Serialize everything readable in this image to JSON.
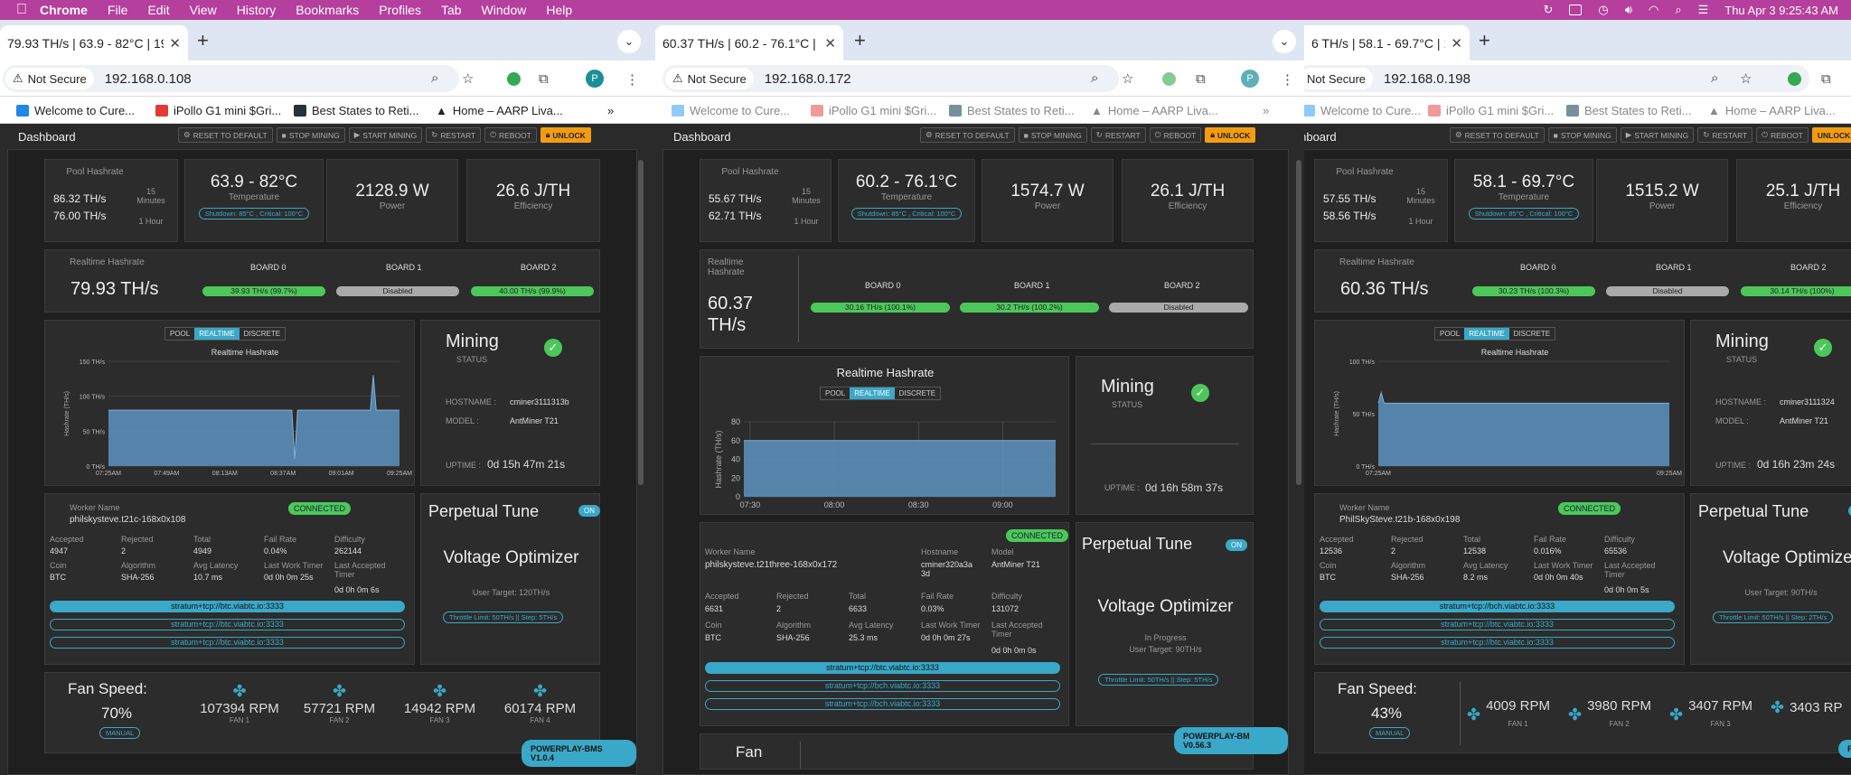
{
  "menubar": {
    "app": "Chrome",
    "items": [
      "File",
      "Edit",
      "View",
      "History",
      "Bookmarks",
      "Profiles",
      "Tab",
      "Window",
      "Help"
    ],
    "clock": "Thu Apr 3  9:25:43 AM"
  },
  "bookmarks": [
    "Welcome to Cure...",
    "iPollo G1 mini $Gri...",
    "Best States to Reti...",
    "Home – AARP Liva..."
  ],
  "common": {
    "not_secure": "Not Secure",
    "dashboard": "Dashboard",
    "buttons": [
      "RESET TO DEFAULT",
      "STOP MINING",
      "START MINING",
      "RESTART",
      "REBOOT"
    ],
    "unlock": "UNLOCK",
    "pool_hashrate": "Pool Hashrate",
    "min15": "15 Minutes",
    "hour1": "1 Hour",
    "temperature": "Temperature",
    "shutdown": "Shutdown: 85°C , Critical: 100°C",
    "power": "Power",
    "efficiency": "Efficiency",
    "realtime_hashrate": "Realtime Hashrate",
    "board0": "BOARD 0",
    "board1": "BOARD 1",
    "board2": "BOARD 2",
    "pool": "POOL",
    "realtime": "REALTIME",
    "discrete": "DISCRETE",
    "mining": "Mining",
    "status": "STATUS",
    "hostname_k": "HOSTNAME :",
    "model_k": "MODEL :",
    "uptime_k": "UPTIME :",
    "worker_name": "Worker Name",
    "connected": "CONNECTED",
    "accepted": "Accepted",
    "rejected": "Rejected",
    "total": "Total",
    "fail_rate": "Fail Rate",
    "difficulty": "Difficulty",
    "coin": "Coin",
    "algorithm": "Algorithm",
    "avg_latency": "Avg Latency",
    "last_work_timer": "Last Work Timer",
    "last_accepted_timer": "Last Accepted Timer",
    "perpetual_tune": "Perpetual Tune",
    "on": "ON",
    "voltage_optimizer": "Voltage Optimizer",
    "fan_speed": "Fan Speed:",
    "manual": "MANUAL",
    "hostname_h": "Hostname",
    "model_h": "Model",
    "fan": "Fan",
    "y_axis": "Hashrate (TH/s)"
  },
  "w1": {
    "tab": "79.93 TH/s | 63.9 - 82°C | 19",
    "url": "192.168.0.108",
    "pool15": "86.32 TH/s",
    "pool1h": "76.00 TH/s",
    "temp": "63.9 - 82°C",
    "power": "2128.9 W",
    "eff": "26.6 J/TH",
    "rt": "79.93 TH/s",
    "b0": "39.93 TH/s (99.7%)",
    "b1": "Disabled",
    "b2": "40.00 TH/s (99.9%)",
    "chart_title": "Realtime Hashrate",
    "hostname": "cminer3111313b",
    "model": "AntMiner T21",
    "uptime": "0d 15h 47m 21s",
    "worker": "philskysteve.t21c-168x0x108",
    "accepted": "4947",
    "rejected": "2",
    "total": "4949",
    "fail": "0.04%",
    "diff": "262144",
    "coin": "BTC",
    "algo": "SHA-256",
    "lat": "10.7 ms",
    "lwt": "0d 0h 0m 25s",
    "lat2": "0d 0h 0m 6s",
    "pools": [
      "stratum+tcp://btc.viabtc.io:3333",
      "stratum+tcp://btc.viabtc.io:3333",
      "stratum+tcp://btc.viabtc.io:3333"
    ],
    "target": "User Target: 120TH/s",
    "throttle": "Throttle Limit: 50TH/s || Step: 5TH/s",
    "fan_pct": "70%",
    "fans": [
      {
        "rpm": "107394 RPM",
        "l": "FAN 1"
      },
      {
        "rpm": "57721 RPM",
        "l": "FAN 2"
      },
      {
        "rpm": "14942 RPM",
        "l": "FAN 3"
      },
      {
        "rpm": "60174 RPM",
        "l": "FAN 4"
      }
    ],
    "version": "POWERPLAY-BMS V1.0.4"
  },
  "w2": {
    "tab": "60.37 TH/s | 60.2 - 76.1°C | 1",
    "url": "192.168.0.172",
    "pool15": "55.67 TH/s",
    "pool1h": "62.71 TH/s",
    "temp": "60.2 - 76.1°C",
    "power": "1574.7 W",
    "eff": "26.1 J/TH",
    "rt1": "60.37",
    "rt2": "TH/s",
    "b0": "30.16 TH/s (100.1%)",
    "b1": "30.2 TH/s (100.2%)",
    "b2": "Disabled",
    "chart_title": "Realtime Hashrate",
    "uptime": "0d 16h 58m 37s",
    "worker": "philskysteve.t21three-168x0x172",
    "hostname": "cminer320a3a3d",
    "model": "AntMiner T21",
    "accepted": "6631",
    "rejected": "2",
    "total": "6633",
    "fail": "0.03%",
    "diff": "131072",
    "coin": "BTC",
    "algo": "SHA-256",
    "lat": "25.3 ms",
    "lwt": "0d 0h 0m 27s",
    "lat2": "0d 0h 0m 0s",
    "pools": [
      "stratum+tcp://btc.viabtc.io:3333",
      "stratum+tcp://bch.viabtc.io:3333",
      "stratum+tcp://bch.viabtc.io:3333"
    ],
    "progress": "In Progress",
    "target": "User Target: 90TH/s",
    "throttle": "Throttle Limit: 50TH/s || Step: 5TH/s",
    "version": "POWERPLAY-BM V0.56.3"
  },
  "w3": {
    "tab": "6 TH/s | 58.1 - 69.7°C | 1",
    "url": "192.168.0.198",
    "pool15": "57.55 TH/s",
    "pool1h": "58.56 TH/s",
    "temp": "58.1 - 69.7°C",
    "power": "1515.2 W",
    "eff": "25.1 J/TH",
    "rt": "60.36 TH/s",
    "b0": "30.23 TH/s (100.3%)",
    "b1": "Disabled",
    "b2": "30.14 TH/s (100%)",
    "chart_title": "Realtime Hashrate",
    "hostname": "cminer3111324",
    "model": "AntMiner T21",
    "uptime": "0d 16h 23m 24s",
    "worker": "PhilSkySteve.t21b-168x0x198",
    "accepted": "12536",
    "rejected": "2",
    "total": "12538",
    "fail": "0.016%",
    "diff": "65536",
    "coin": "BTC",
    "algo": "SHA-256",
    "lat": "8.2 ms",
    "lwt": "0d 0h 0m 40s",
    "lat2": "0d 0h 0m 5s",
    "pools": [
      "stratum+tcp://bch.viabtc.io:3333",
      "stratum+tcp://btc.viabtc.io:3333",
      "stratum+tcp://btc.viabtc.io:3333"
    ],
    "target": "User Target: 90TH/s",
    "throttle": "Throttle Limit: 50TH/s || Step: 2TH/s",
    "fan_pct": "43%",
    "fans": [
      {
        "rpm": "4009 RPM",
        "l": "FAN 1"
      },
      {
        "rpm": "3980 RPM",
        "l": "FAN 2"
      },
      {
        "rpm": "3407 RPM",
        "l": "FAN 3"
      },
      {
        "rpm": "3403 RP",
        "l": ""
      }
    ],
    "version": "POWERPLAY-"
  },
  "chart_data": [
    {
      "type": "area",
      "title": "Realtime Hashrate",
      "ylabel": "Hashrate (TH/s)",
      "yticks": [
        "0 TH/s",
        "50 TH/s",
        "100 TH/s",
        "150 TH/s"
      ],
      "xticks": [
        "07:25AM",
        "07:49AM",
        "08:13AM",
        "08:37AM",
        "09:01AM",
        "09:25AM"
      ],
      "ylim": [
        0,
        150
      ],
      "x": [
        0,
        0.2,
        0.4,
        0.55,
        0.63,
        0.64,
        0.65,
        0.8,
        0.9,
        0.91,
        0.92,
        1
      ],
      "values": [
        80,
        80,
        80,
        80,
        80,
        10,
        80,
        80,
        80,
        130,
        80,
        80
      ]
    },
    {
      "type": "area",
      "title": "Realtime Hashrate",
      "ylabel": "Hashrate (TH/s)",
      "yticks": [
        "0",
        "20",
        "40",
        "60",
        "80"
      ],
      "xticks": [
        "07:30",
        "08:00",
        "08:30",
        "09:00"
      ],
      "ylim": [
        0,
        80
      ],
      "x": [
        0,
        0.5,
        1
      ],
      "values": [
        60,
        60,
        60
      ]
    },
    {
      "type": "area",
      "title": "Realtime Hashrate",
      "ylabel": "Hashrate (TH/s)",
      "yticks": [
        "0 TH/s",
        "50 TH/s",
        "100 TH/s"
      ],
      "xticks": [
        "07:25AM",
        "09:25AM"
      ],
      "ylim": [
        0,
        100
      ],
      "x": [
        0,
        0.01,
        0.02,
        0.5,
        1
      ],
      "values": [
        60,
        70,
        60,
        60,
        60
      ]
    }
  ]
}
